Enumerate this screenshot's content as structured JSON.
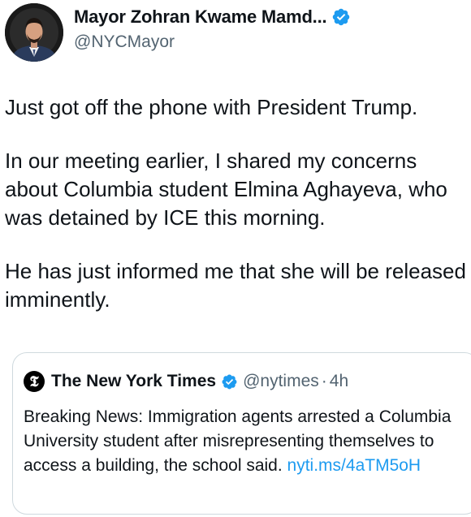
{
  "author": {
    "display_name": "Mayor Zohran Kwame Mamd...",
    "handle": "@NYCMayor",
    "avatar_icon": "profile-photo",
    "verified_icon": "verified-badge-icon"
  },
  "tweet": {
    "paragraphs": [
      "Just got off the phone with President Trump.",
      "In our meeting earlier, I shared my concerns about Columbia student Elmina Aghayeva, who was detained by ICE this morning.",
      "He has just informed me that she will be released imminently."
    ]
  },
  "quote": {
    "logo_letter": "𝕿",
    "display_name": "The New York Times",
    "handle": "@nytimes",
    "separator": "·",
    "time": "4h",
    "text": "Breaking News: Immigration agents arrested a Columbia University student after misrepresenting themselves to access a building, the school said.",
    "link": "nyti.ms/4aTM5oH"
  },
  "colors": {
    "text": "#0f1419",
    "secondary": "#536471",
    "link": "#1d9bf0",
    "verified": "#1d9bf0",
    "border": "#cfd9de"
  }
}
